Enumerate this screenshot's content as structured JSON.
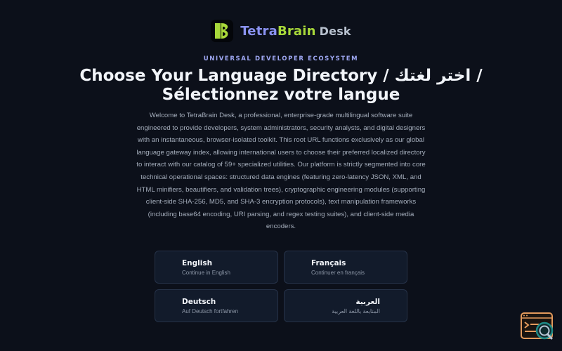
{
  "brand": {
    "name_part1": "Tetra",
    "name_part2": "Brain",
    "name_part3": "Desk"
  },
  "header": {
    "eyebrow": "UNIVERSAL DEVELOPER ECOSYSTEM",
    "title": "Choose Your Language Directory / اختر لغتك / Sélectionnez votre langue",
    "intro": "Welcome to TetraBrain Desk, a professional, enterprise-grade multilingual software suite engineered to provide developers, system administrators, security analysts, and digital designers with an instantaneous, browser-isolated toolkit. This root URL functions exclusively as our global language gateway index, allowing international users to choose their preferred localized directory to interact with our catalog of 59+ specialized utilities. Our platform is strictly segmented into core technical operational spaces: structured data engines (featuring zero-latency JSON, XML, and HTML minifiers, beautifiers, and validation trees), cryptographic engineering modules (supporting client-side SHA-256, MD5, and SHA-3 encryption protocols), text manipulation frameworks (including base64 encoding, URI parsing, and regex testing suites), and client-side media encoders."
  },
  "languages": [
    {
      "title": "English",
      "subtitle": "Continue in English"
    },
    {
      "title": "Français",
      "subtitle": "Continuer en français"
    },
    {
      "title": "Deutsch",
      "subtitle": "Auf Deutsch fortfahren"
    },
    {
      "title": "العربية",
      "subtitle": "المتابعة باللغة العربية"
    }
  ],
  "icons": {
    "logo": "leaf-logo-icon",
    "widget": "terminal-search-icon"
  },
  "colors": {
    "background": "#0c101a",
    "card": "#121b2b",
    "card_border": "#263248",
    "brand_primary": "#8b93f2",
    "brand_accent": "#a8d83a",
    "widget_accent": "#e39a5c",
    "widget_teal": "#1f8a86"
  }
}
